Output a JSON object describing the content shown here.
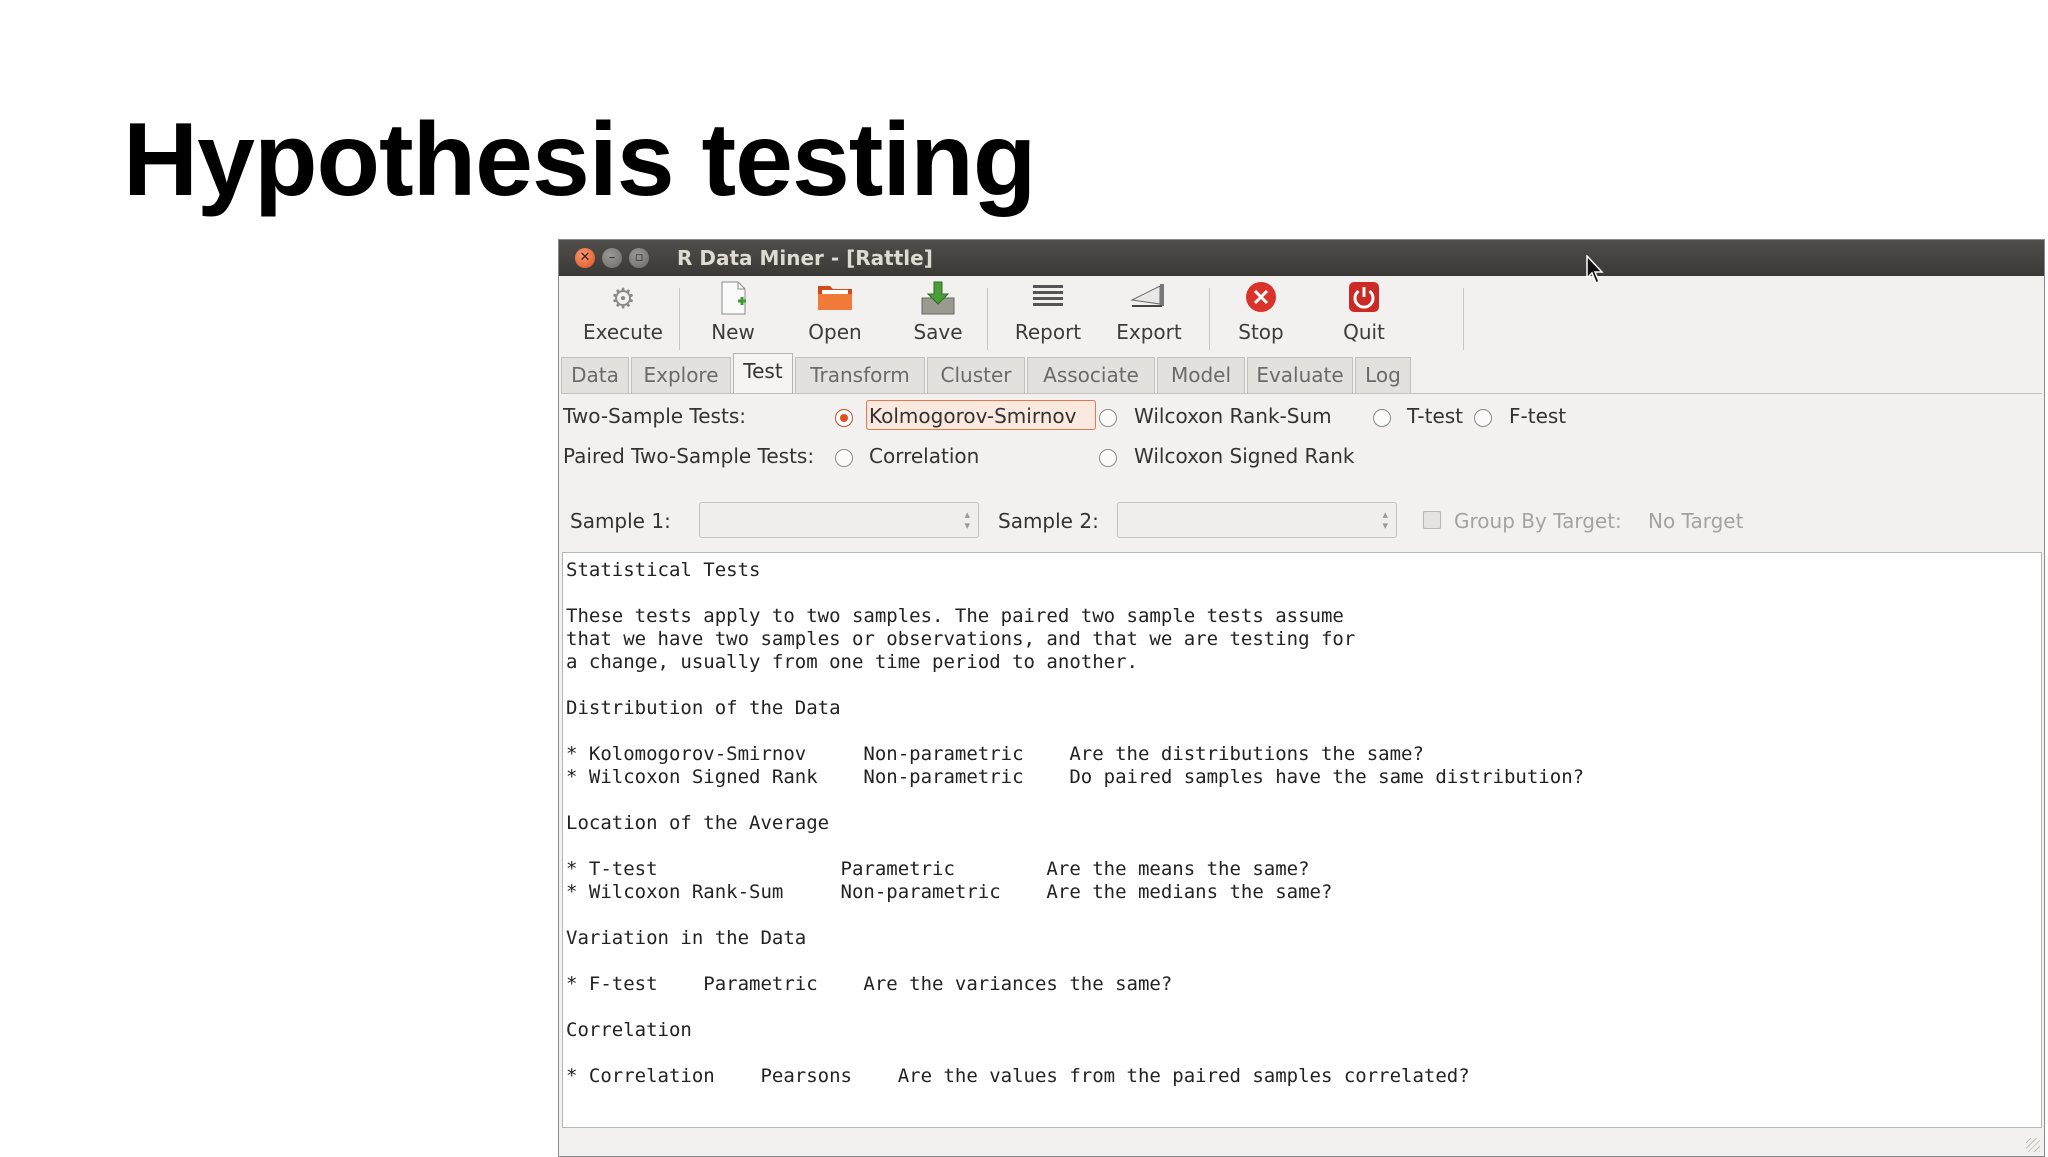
{
  "slide": {
    "title": "Hypothesis testing"
  },
  "window": {
    "title": "R Data Miner - [Rattle]"
  },
  "toolbar": {
    "items": [
      {
        "label": "Execute",
        "icon": "gears-icon"
      },
      {
        "label": "New",
        "icon": "new-document-icon"
      },
      {
        "label": "Open",
        "icon": "folder-open-icon"
      },
      {
        "label": "Save",
        "icon": "save-icon"
      },
      {
        "label": "Report",
        "icon": "report-icon"
      },
      {
        "label": "Export",
        "icon": "export-icon"
      },
      {
        "label": "Stop",
        "icon": "stop-icon"
      },
      {
        "label": "Quit",
        "icon": "power-icon"
      }
    ]
  },
  "tabs": [
    "Data",
    "Explore",
    "Test",
    "Transform",
    "Cluster",
    "Associate",
    "Model",
    "Evaluate",
    "Log"
  ],
  "active_tab": "Test",
  "tests": {
    "two_sample_label": "Two-Sample Tests:",
    "paired_label": "Paired Two-Sample Tests:",
    "options": [
      {
        "label": "Kolmogorov-Smirnov",
        "selected": true
      },
      {
        "label": "Wilcoxon Rank-Sum",
        "selected": false
      },
      {
        "label": "T-test",
        "selected": false
      },
      {
        "label": "F-test",
        "selected": false
      },
      {
        "label": "Correlation",
        "selected": false
      },
      {
        "label": "Wilcoxon Signed Rank",
        "selected": false
      }
    ]
  },
  "samples": {
    "sample1_label": "Sample 1:",
    "sample1_value": "",
    "sample2_label": "Sample 2:",
    "sample2_value": "",
    "group_label": "Group By Target:",
    "target_value": "No Target"
  },
  "textview": {
    "lines": [
      "Statistical Tests",
      "",
      "These tests apply to two samples. The paired two sample tests assume",
      "that we have two samples or observations, and that we are testing for",
      "a change, usually from one time period to another.",
      "",
      "Distribution of the Data",
      "",
      "* Kolomogorov-Smirnov     Non-parametric    Are the distributions the same?",
      "* Wilcoxon Signed Rank    Non-parametric    Do paired samples have the same distribution?",
      "",
      "Location of the Average",
      "",
      "* T-test                Parametric        Are the means the same?",
      "* Wilcoxon Rank-Sum     Non-parametric    Are the medians the same?",
      "",
      "Variation in the Data",
      "",
      "* F-test    Parametric    Are the variances the same?",
      "",
      "Correlation",
      "",
      "* Correlation    Pearsons    Are the values from the paired samples correlated?"
    ]
  },
  "colors": {
    "accent": "#e0501e",
    "titlebar": "#3c3b37",
    "stop": "#d9342b",
    "quit": "#cc2a26"
  }
}
